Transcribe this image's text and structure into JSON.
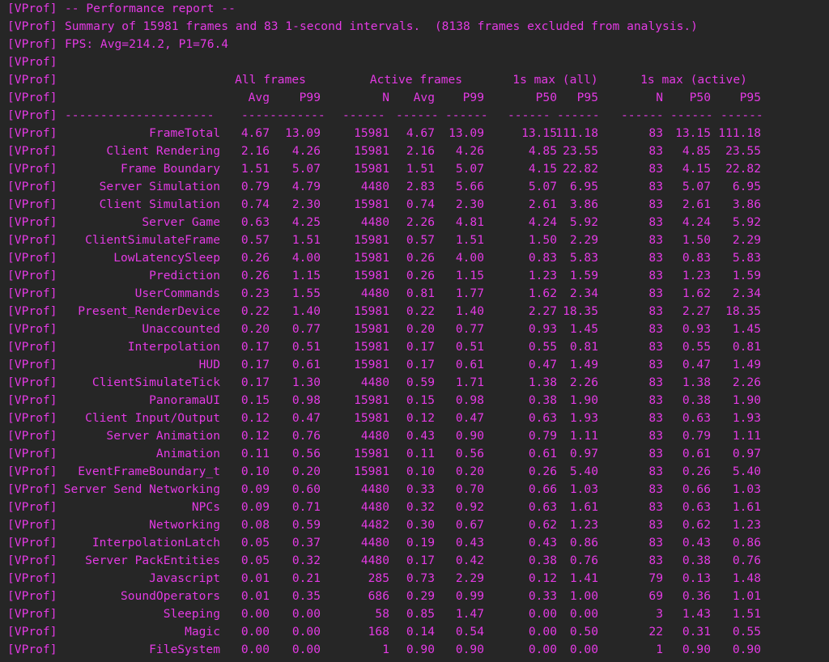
{
  "prefix": "[VProf]",
  "header_lines": [
    "-- Performance report --",
    "Summary of 15981 frames and 83 1-second intervals.  (8138 frames excluded from analysis.)",
    "FPS: Avg=214.2, P1=76.4",
    ""
  ],
  "group_headers": [
    "All frames",
    "Active frames",
    "1s max (all)",
    "1s max (active)"
  ],
  "columns": [
    "Avg",
    "P99",
    "N",
    "Avg",
    "P99",
    "P50",
    "P95",
    "N",
    "P50",
    "P95"
  ],
  "separators": [
    "---------------------",
    "------",
    "------",
    "------",
    "------",
    "------",
    "------",
    "------",
    "------",
    "------",
    "------"
  ],
  "rows": [
    [
      "FrameTotal",
      "4.67",
      "13.09",
      "15981",
      "4.67",
      "13.09",
      "13.15",
      "111.18",
      "83",
      "13.15",
      "111.18"
    ],
    [
      "Client Rendering",
      "2.16",
      "4.26",
      "15981",
      "2.16",
      "4.26",
      "4.85",
      "23.55",
      "83",
      "4.85",
      "23.55"
    ],
    [
      "Frame Boundary",
      "1.51",
      "5.07",
      "15981",
      "1.51",
      "5.07",
      "4.15",
      "22.82",
      "83",
      "4.15",
      "22.82"
    ],
    [
      "Server Simulation",
      "0.79",
      "4.79",
      "4480",
      "2.83",
      "5.66",
      "5.07",
      "6.95",
      "83",
      "5.07",
      "6.95"
    ],
    [
      "Client Simulation",
      "0.74",
      "2.30",
      "15981",
      "0.74",
      "2.30",
      "2.61",
      "3.86",
      "83",
      "2.61",
      "3.86"
    ],
    [
      "Server Game",
      "0.63",
      "4.25",
      "4480",
      "2.26",
      "4.81",
      "4.24",
      "5.92",
      "83",
      "4.24",
      "5.92"
    ],
    [
      "ClientSimulateFrame",
      "0.57",
      "1.51",
      "15981",
      "0.57",
      "1.51",
      "1.50",
      "2.29",
      "83",
      "1.50",
      "2.29"
    ],
    [
      "LowLatencySleep",
      "0.26",
      "4.00",
      "15981",
      "0.26",
      "4.00",
      "0.83",
      "5.83",
      "83",
      "0.83",
      "5.83"
    ],
    [
      "Prediction",
      "0.26",
      "1.15",
      "15981",
      "0.26",
      "1.15",
      "1.23",
      "1.59",
      "83",
      "1.23",
      "1.59"
    ],
    [
      "UserCommands",
      "0.23",
      "1.55",
      "4480",
      "0.81",
      "1.77",
      "1.62",
      "2.34",
      "83",
      "1.62",
      "2.34"
    ],
    [
      "Present_RenderDevice",
      "0.22",
      "1.40",
      "15981",
      "0.22",
      "1.40",
      "2.27",
      "18.35",
      "83",
      "2.27",
      "18.35"
    ],
    [
      "Unaccounted",
      "0.20",
      "0.77",
      "15981",
      "0.20",
      "0.77",
      "0.93",
      "1.45",
      "83",
      "0.93",
      "1.45"
    ],
    [
      "Interpolation",
      "0.17",
      "0.51",
      "15981",
      "0.17",
      "0.51",
      "0.55",
      "0.81",
      "83",
      "0.55",
      "0.81"
    ],
    [
      "HUD",
      "0.17",
      "0.61",
      "15981",
      "0.17",
      "0.61",
      "0.47",
      "1.49",
      "83",
      "0.47",
      "1.49"
    ],
    [
      "ClientSimulateTick",
      "0.17",
      "1.30",
      "4480",
      "0.59",
      "1.71",
      "1.38",
      "2.26",
      "83",
      "1.38",
      "2.26"
    ],
    [
      "PanoramaUI",
      "0.15",
      "0.98",
      "15981",
      "0.15",
      "0.98",
      "0.38",
      "1.90",
      "83",
      "0.38",
      "1.90"
    ],
    [
      "Client Input/Output",
      "0.12",
      "0.47",
      "15981",
      "0.12",
      "0.47",
      "0.63",
      "1.93",
      "83",
      "0.63",
      "1.93"
    ],
    [
      "Server Animation",
      "0.12",
      "0.76",
      "4480",
      "0.43",
      "0.90",
      "0.79",
      "1.11",
      "83",
      "0.79",
      "1.11"
    ],
    [
      "Animation",
      "0.11",
      "0.56",
      "15981",
      "0.11",
      "0.56",
      "0.61",
      "0.97",
      "83",
      "0.61",
      "0.97"
    ],
    [
      "EventFrameBoundary_t",
      "0.10",
      "0.20",
      "15981",
      "0.10",
      "0.20",
      "0.26",
      "5.40",
      "83",
      "0.26",
      "5.40"
    ],
    [
      "Server Send Networking",
      "0.09",
      "0.60",
      "4480",
      "0.33",
      "0.70",
      "0.66",
      "1.03",
      "83",
      "0.66",
      "1.03"
    ],
    [
      "NPCs",
      "0.09",
      "0.71",
      "4480",
      "0.32",
      "0.92",
      "0.63",
      "1.61",
      "83",
      "0.63",
      "1.61"
    ],
    [
      "Networking",
      "0.08",
      "0.59",
      "4482",
      "0.30",
      "0.67",
      "0.62",
      "1.23",
      "83",
      "0.62",
      "1.23"
    ],
    [
      "InterpolationLatch",
      "0.05",
      "0.37",
      "4480",
      "0.19",
      "0.43",
      "0.43",
      "0.86",
      "83",
      "0.43",
      "0.86"
    ],
    [
      "Server PackEntities",
      "0.05",
      "0.32",
      "4480",
      "0.17",
      "0.42",
      "0.38",
      "0.76",
      "83",
      "0.38",
      "0.76"
    ],
    [
      "Javascript",
      "0.01",
      "0.21",
      "285",
      "0.73",
      "2.29",
      "0.12",
      "1.41",
      "79",
      "0.13",
      "1.48"
    ],
    [
      "SoundOperators",
      "0.01",
      "0.35",
      "686",
      "0.29",
      "0.99",
      "0.33",
      "1.00",
      "69",
      "0.36",
      "1.01"
    ],
    [
      "Sleeping",
      "0.00",
      "0.00",
      "58",
      "0.85",
      "1.47",
      "0.00",
      "0.00",
      "3",
      "1.43",
      "1.51"
    ],
    [
      "Magic",
      "0.00",
      "0.00",
      "168",
      "0.14",
      "0.54",
      "0.00",
      "0.50",
      "22",
      "0.31",
      "0.55"
    ],
    [
      "FileSystem",
      "0.00",
      "0.00",
      "1",
      "0.90",
      "0.90",
      "0.00",
      "0.00",
      "1",
      "0.90",
      "0.90"
    ]
  ],
  "text_color": "#e33ae3",
  "background": "#262626"
}
